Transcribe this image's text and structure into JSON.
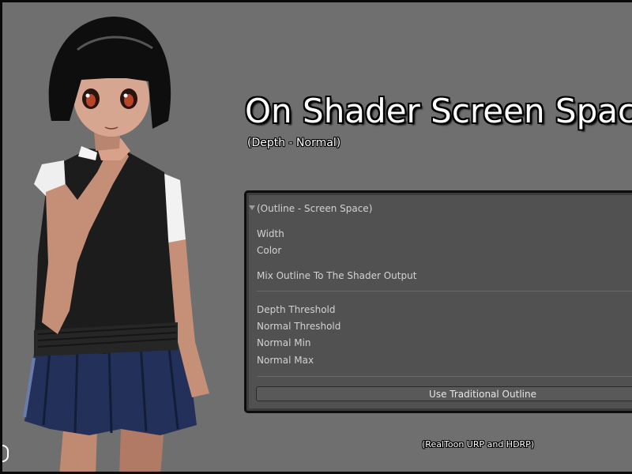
{
  "heading": {
    "title": "On Shader Screen Space Outline",
    "subtitle": "(Depth - Normal)"
  },
  "inspector": {
    "foldout_label": "(Outline - Screen Space)",
    "properties": [
      "Width",
      "Color",
      "Mix Outline To The Shader Output",
      "Depth Threshold",
      "Normal Threshold",
      "Normal Min",
      "Normal Max"
    ],
    "button_label": "Use Traditional Outline"
  },
  "footer": {
    "note": "(RealToon URP and HDRP)"
  },
  "illustration": {
    "icon": "anime-girl-character"
  }
}
